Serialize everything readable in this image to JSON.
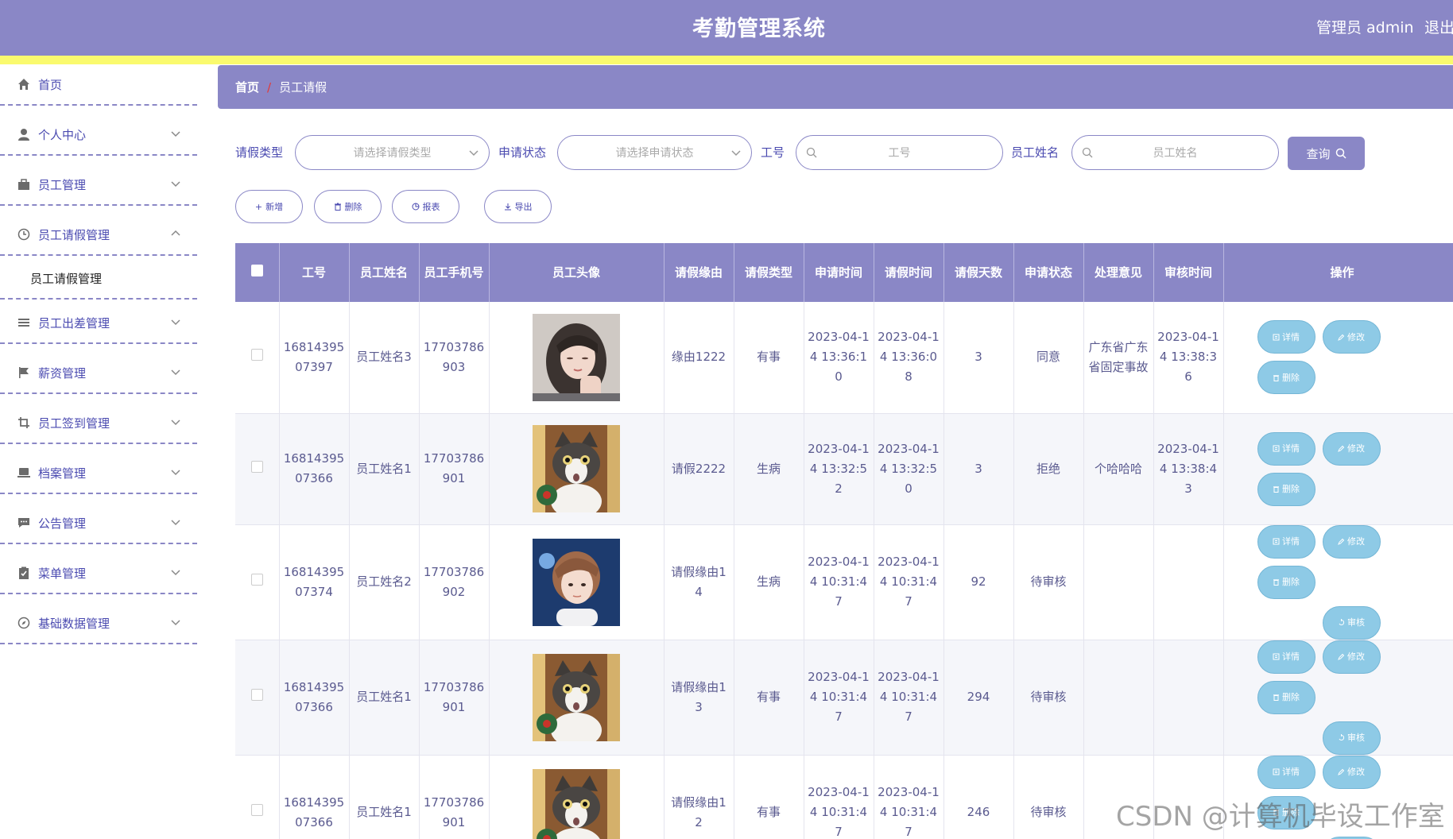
{
  "header": {
    "title": "考勤管理系统",
    "user": "管理员 admin",
    "logout": "退出"
  },
  "sidebar": {
    "items": [
      {
        "label": "首页",
        "icon": "home-icon"
      },
      {
        "label": "个人中心",
        "icon": "user-icon"
      },
      {
        "label": "员工管理",
        "icon": "briefcase-icon"
      },
      {
        "label": "员工请假管理",
        "icon": "clock-icon"
      },
      {
        "label": "员工出差管理",
        "icon": "list-icon"
      },
      {
        "label": "薪资管理",
        "icon": "flag-icon"
      },
      {
        "label": "员工签到管理",
        "icon": "crop-icon"
      },
      {
        "label": "档案管理",
        "icon": "laptop-icon"
      },
      {
        "label": "公告管理",
        "icon": "chat-icon"
      },
      {
        "label": "菜单管理",
        "icon": "clipboard-icon"
      },
      {
        "label": "基础数据管理",
        "icon": "compass-icon"
      }
    ],
    "sub_item": "员工请假管理"
  },
  "breadcrumb": {
    "home": "首页",
    "separator": "/",
    "current": "员工请假"
  },
  "filters": {
    "leave_type_label": "请假类型",
    "leave_type_placeholder": "请选择请假类型",
    "status_label": "申请状态",
    "status_placeholder": "请选择申请状态",
    "emp_no_label": "工号",
    "emp_no_placeholder": "工号",
    "emp_name_label": "员工姓名",
    "emp_name_placeholder": "员工姓名",
    "query_label": "查询"
  },
  "actions": {
    "add": "新增",
    "delete": "删除",
    "report": "报表",
    "export": "导出"
  },
  "table": {
    "headers": [
      "工号",
      "员工姓名",
      "员工手机号",
      "员工头像",
      "请假缘由",
      "请假类型",
      "申请时间",
      "请假时间",
      "请假天数",
      "申请状态",
      "处理意见",
      "审核时间",
      "操作"
    ],
    "rows": [
      {
        "emp_no": "1681439507397",
        "name": "员工姓名3",
        "phone": "17703786903",
        "avatar": "girl",
        "reason": "缘由1222",
        "type": "有事",
        "apply_time": "2023-04-14 13:36:10",
        "leave_time": "2023-04-14 13:36:08",
        "days": "3",
        "status": "同意",
        "opinion": "广东省广东省固定事故",
        "review_time": "2023-04-14 13:38:36",
        "review": false
      },
      {
        "emp_no": "1681439507366",
        "name": "员工姓名1",
        "phone": "17703786901",
        "avatar": "cat",
        "reason": "请假2222",
        "type": "生病",
        "apply_time": "2023-04-14 13:32:52",
        "leave_time": "2023-04-14 13:32:50",
        "days": "3",
        "status": "拒绝",
        "opinion": "个哈哈哈",
        "review_time": "2023-04-14 13:38:43",
        "review": false
      },
      {
        "emp_no": "1681439507374",
        "name": "员工姓名2",
        "phone": "17703786902",
        "avatar": "boy",
        "reason": "请假缘由14",
        "type": "生病",
        "apply_time": "2023-04-14 10:31:47",
        "leave_time": "2023-04-14 10:31:47",
        "days": "92",
        "status": "待审核",
        "opinion": "",
        "review_time": "",
        "review": true
      },
      {
        "emp_no": "1681439507366",
        "name": "员工姓名1",
        "phone": "17703786901",
        "avatar": "cat",
        "reason": "请假缘由13",
        "type": "有事",
        "apply_time": "2023-04-14 10:31:47",
        "leave_time": "2023-04-14 10:31:47",
        "days": "294",
        "status": "待审核",
        "opinion": "",
        "review_time": "",
        "review": true
      },
      {
        "emp_no": "1681439507366",
        "name": "员工姓名1",
        "phone": "17703786901",
        "avatar": "cat",
        "reason": "请假缘由12",
        "type": "有事",
        "apply_time": "2023-04-14 10:31:47",
        "leave_time": "2023-04-14 10:31:47",
        "days": "246",
        "status": "待审核",
        "opinion": "",
        "review_time": "",
        "review": true
      }
    ],
    "row_actions": {
      "detail": "详情",
      "edit": "修改",
      "delete": "删除",
      "review": "审核"
    }
  },
  "watermark": "CSDN @计算机毕设工作室",
  "colors": {
    "primary": "#8a87c6",
    "accent_bar": "#fafa6e",
    "op_button": "#8ecae6",
    "breadcrumb_sep": "#e53935"
  }
}
